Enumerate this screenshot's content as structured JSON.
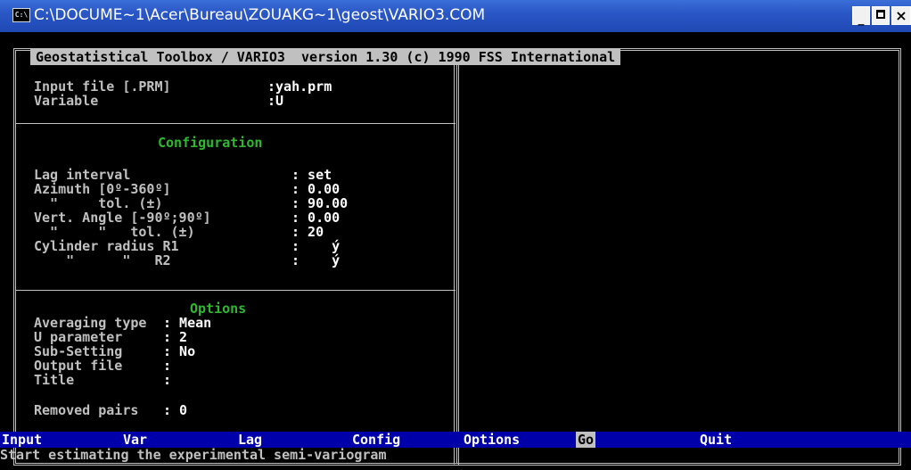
{
  "window": {
    "title": "C:\\DOCUME~1\\Acer\\Bureau\\ZOUAKG~1\\geost\\VARIO3.COM",
    "icon": "console-icon",
    "min_label": "_",
    "close_label": "×"
  },
  "header": "Geostatistical Toolbox / VARIO3  version 1.30 (c) 1990 FSS International",
  "input": {
    "file_label": "Input file [.PRM]",
    "file_value": ":yah.prm",
    "variable_label": "Variable",
    "variable_value": ":U"
  },
  "configuration": {
    "title": "Configuration",
    "rows": [
      {
        "label": "Lag interval        ",
        "value": ": set"
      },
      {
        "label": "Azimuth [0º-360º]   ",
        "value": ": 0.00"
      },
      {
        "label": "  \"     tol. (±)    ",
        "value": ": 90.00"
      },
      {
        "label": "Vert. Angle [-90º;90º] ",
        "value": ": 0.00"
      },
      {
        "label": "  \"     \"   tol. (±) ",
        "value": ": 20"
      },
      {
        "label": "Cylinder radius R1  ",
        "value": ":    ý"
      },
      {
        "label": "    \"      \"   R2  ",
        "value": ":    ý"
      }
    ]
  },
  "options": {
    "title": "Options",
    "rows": [
      {
        "label": "Averaging type ",
        "value": ": Mean"
      },
      {
        "label": "U parameter    ",
        "value": ": 2"
      },
      {
        "label": "Sub-Setting    ",
        "value": ": No"
      },
      {
        "label": "Output file    ",
        "value": ":"
      },
      {
        "label": "Title          ",
        "value": ":"
      },
      {
        "label": "Removed pairs  ",
        "value": ": 0"
      }
    ]
  },
  "menu": {
    "items": [
      "Input",
      "Var",
      "Lag",
      "Config",
      "Options",
      "Go",
      "Quit"
    ],
    "selected": "Go"
  },
  "status": "Start estimating the experimental semi-variogram",
  "colors": {
    "menu_bg": "#0000aa",
    "section_title": "#2fb82f",
    "text": "#c0c0c0"
  }
}
